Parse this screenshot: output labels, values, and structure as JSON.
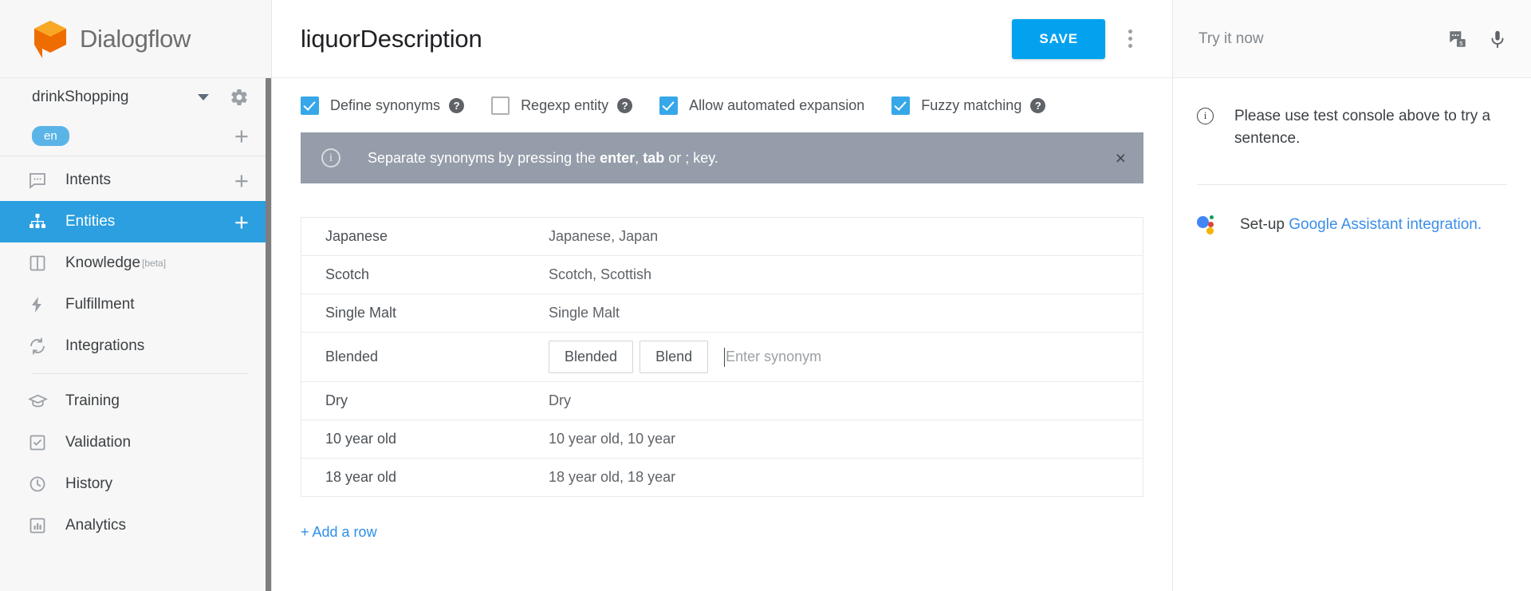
{
  "brand": {
    "name": "Dialogflow"
  },
  "sidebar": {
    "project": "drinkShopping",
    "language": "en",
    "items": [
      {
        "label": "Intents",
        "icon": "chat-bubble-icon",
        "active": false,
        "plus": true
      },
      {
        "label": "Entities",
        "icon": "entities-tree-icon",
        "active": true,
        "plus": true
      },
      {
        "label": "Knowledge",
        "badge": "[beta]",
        "icon": "book-icon",
        "active": false,
        "plus": false
      },
      {
        "label": "Fulfillment",
        "icon": "bolt-icon",
        "active": false,
        "plus": false
      },
      {
        "label": "Integrations",
        "icon": "sync-icon",
        "active": false,
        "plus": false
      },
      {
        "label": "Training",
        "icon": "graduation-cap-icon",
        "active": false,
        "plus": false
      },
      {
        "label": "Validation",
        "icon": "checkbox-icon",
        "active": false,
        "plus": false
      },
      {
        "label": "History",
        "icon": "clock-icon",
        "active": false,
        "plus": false
      },
      {
        "label": "Analytics",
        "icon": "bar-chart-icon",
        "active": false,
        "plus": false
      }
    ]
  },
  "header": {
    "title": "liquorDescription",
    "save_label": "SAVE",
    "menu_icon": "more-vert-icon"
  },
  "options": [
    {
      "label": "Define synonyms",
      "checked": true,
      "help": "?"
    },
    {
      "label": "Regexp entity",
      "checked": false,
      "help": "?"
    },
    {
      "label": "Allow automated expansion",
      "checked": true,
      "help": null
    },
    {
      "label": "Fuzzy matching",
      "checked": true,
      "help": "?"
    }
  ],
  "banner": {
    "text_before": "Separate synonyms by pressing the ",
    "key1": "enter",
    "mid": ", ",
    "key2": "tab",
    "text_after": " or ; key.",
    "close": "×",
    "color": "#959daa"
  },
  "table": {
    "rows": [
      {
        "key": "Japanese",
        "value": "Japanese, Japan",
        "editing": false
      },
      {
        "key": "Scotch",
        "value": "Scotch, Scottish",
        "editing": false
      },
      {
        "key": "Single Malt",
        "value": "Single Malt",
        "editing": false
      },
      {
        "key": "Blended",
        "value": "",
        "editing": true,
        "chips": [
          "Blended",
          "Blend"
        ],
        "placeholder": "Enter synonym"
      },
      {
        "key": "Dry",
        "value": "Dry",
        "editing": false
      },
      {
        "key": "10 year old",
        "value": "10 year old, 10 year",
        "editing": false
      },
      {
        "key": "18 year old",
        "value": "18 year old, 18 year",
        "editing": false
      }
    ],
    "add_row_label": "+ Add a row"
  },
  "right": {
    "try_placeholder": "Try it now",
    "icons": [
      "dialog-test-icon",
      "microphone-icon"
    ],
    "note": "Please use test console above to try a sentence.",
    "assistant_prefix": "Set-up ",
    "assistant_link": "Google Assistant integration."
  },
  "colors": {
    "accent": "#2b9fe0",
    "save": "#03a2ef",
    "link": "#3b8ee8",
    "banner": "#959daa"
  }
}
